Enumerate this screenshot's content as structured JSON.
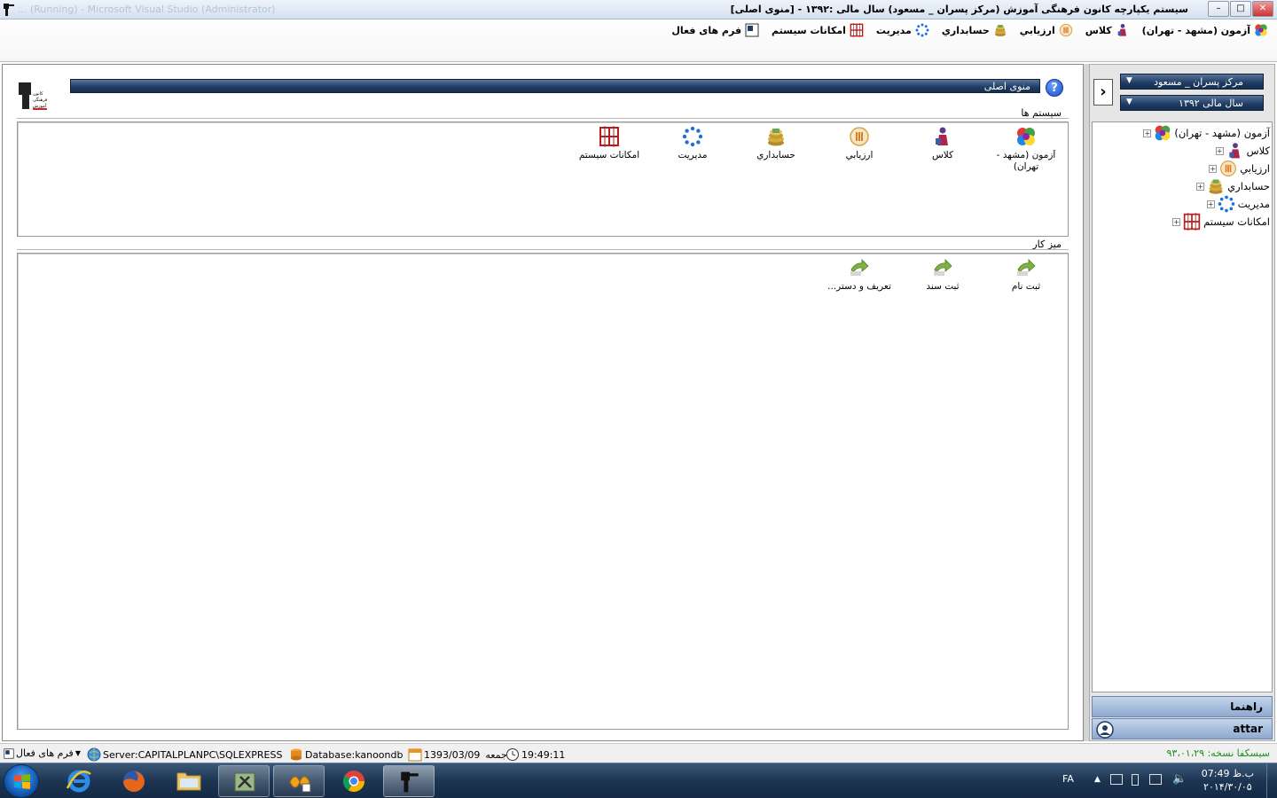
{
  "window": {
    "title": "سیستم یکپارچه کانون فرهنگی آموزش  (مرکز پسران _ مسعود) سال مالی :۱۳۹۲ - [منوی اصلی]",
    "ghost_title": "... (Running) - Microsoft Visual Studio (Administrator)",
    "buttons": {
      "minimize": "–",
      "maximize": "□",
      "close": "✕"
    }
  },
  "menubar": {
    "items": [
      {
        "label": "آزمون (مشهد - تهران)",
        "icon": "colorful-icon"
      },
      {
        "label": "كلاس",
        "icon": "class-icon"
      },
      {
        "label": "ارزيابي",
        "icon": "evaluation-icon"
      },
      {
        "label": "حسابداري",
        "icon": "coins-icon"
      },
      {
        "label": "مديريت",
        "icon": "management-icon"
      },
      {
        "label": "امکانات سیستم",
        "icon": "grid-icon"
      },
      {
        "label": "فرم های فعال",
        "icon": "forms-icon"
      }
    ]
  },
  "main": {
    "header": "منوی اصلی",
    "systems_label": "سیستم ها",
    "desk_label": "میز کار",
    "systems": [
      {
        "label": "آزمون (مشهد - تهران)",
        "icon": "colorful-icon"
      },
      {
        "label": "كلاس",
        "icon": "class-icon"
      },
      {
        "label": "ارزيابي",
        "icon": "evaluation-icon"
      },
      {
        "label": "حسابداري",
        "icon": "coins-icon"
      },
      {
        "label": "مديريت",
        "icon": "management-icon"
      },
      {
        "label": "امکانات سیستم",
        "icon": "grid-icon"
      }
    ],
    "desk": [
      {
        "label": "ثبت نام",
        "icon": "arrow-shortcut-icon"
      },
      {
        "label": "ثبت سند",
        "icon": "arrow-shortcut-icon"
      },
      {
        "label": "تعريف و دستر...",
        "icon": "arrow-shortcut-icon"
      }
    ]
  },
  "side": {
    "center_combo": "مرکز پسران _ مسعود",
    "year_combo": "سال مالی ۱۳۹۲",
    "tree": [
      {
        "label": "آزمون (مشهد - تهران)",
        "icon": "colorful-icon"
      },
      {
        "label": "كلاس",
        "icon": "class-icon"
      },
      {
        "label": "ارزيابي",
        "icon": "evaluation-icon"
      },
      {
        "label": "حسابداري",
        "icon": "coins-icon"
      },
      {
        "label": "مديريت",
        "icon": "management-icon"
      },
      {
        "label": "امکانات سیستم",
        "icon": "grid-icon"
      }
    ],
    "guide_button": "راهنما",
    "user_button": "attar"
  },
  "status": {
    "forms": "فرم های فعال",
    "server": "Server:CAPITALPLANPC\\SQLEXPRESS",
    "database": "Database:kanoondb",
    "date": "1393/03/09",
    "day": "جمعه",
    "time": "19:49:11",
    "version": "سیسکفا  نسخه: ۹۳،۰۱،۲۹"
  },
  "taskbar": {
    "language": "FA",
    "clock_time": "ب.ظ 07:49",
    "clock_date": "۲۰۱۴/۳۰/۰۵"
  },
  "colors": {
    "bar_dark": "#1f3a63",
    "version_green": "#1a8f1a",
    "taskbar": "#1d3552"
  }
}
